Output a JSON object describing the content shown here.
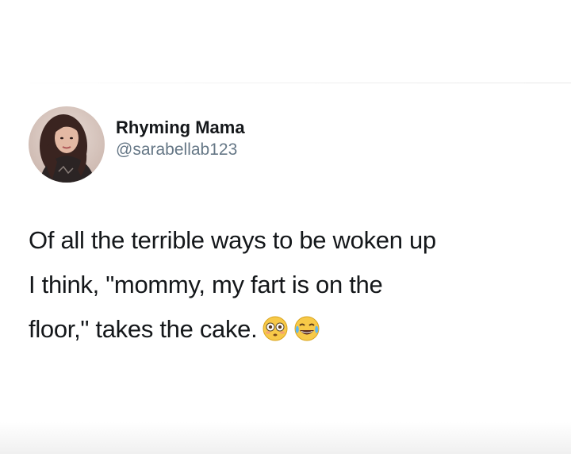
{
  "tweet": {
    "author": {
      "display_name": "Rhyming Mama",
      "handle": "@sarabellab123",
      "avatar_icon": "profile-photo"
    },
    "text_lines": [
      "Of all the terrible ways to be woken up",
      "I think, \"mommy, my fart is on the",
      "floor,\" takes the cake."
    ],
    "emojis": [
      "flushed-face-emoji",
      "tears-of-joy-emoji"
    ]
  }
}
